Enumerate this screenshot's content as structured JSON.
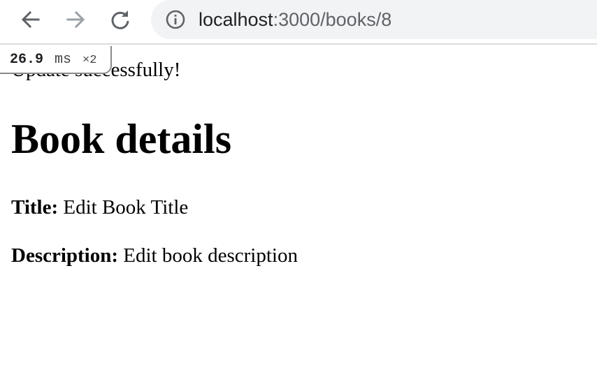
{
  "browser": {
    "url_host": "localhost",
    "url_path": ":3000/books/8"
  },
  "perf": {
    "value": "26.9",
    "unit": "ms",
    "count": "×2"
  },
  "page": {
    "flash": "Update successfully!",
    "heading": "Book details",
    "fields": [
      {
        "label": "Title:",
        "value": "Edit Book Title"
      },
      {
        "label": "Description:",
        "value": "Edit book description"
      }
    ]
  },
  "colors": {
    "toolbar_background": "#ffffff",
    "omnibox_background": "#f1f3f4",
    "icon_dark": "#5f6368",
    "icon_disabled": "#9aa0a6",
    "text": "#000000"
  }
}
